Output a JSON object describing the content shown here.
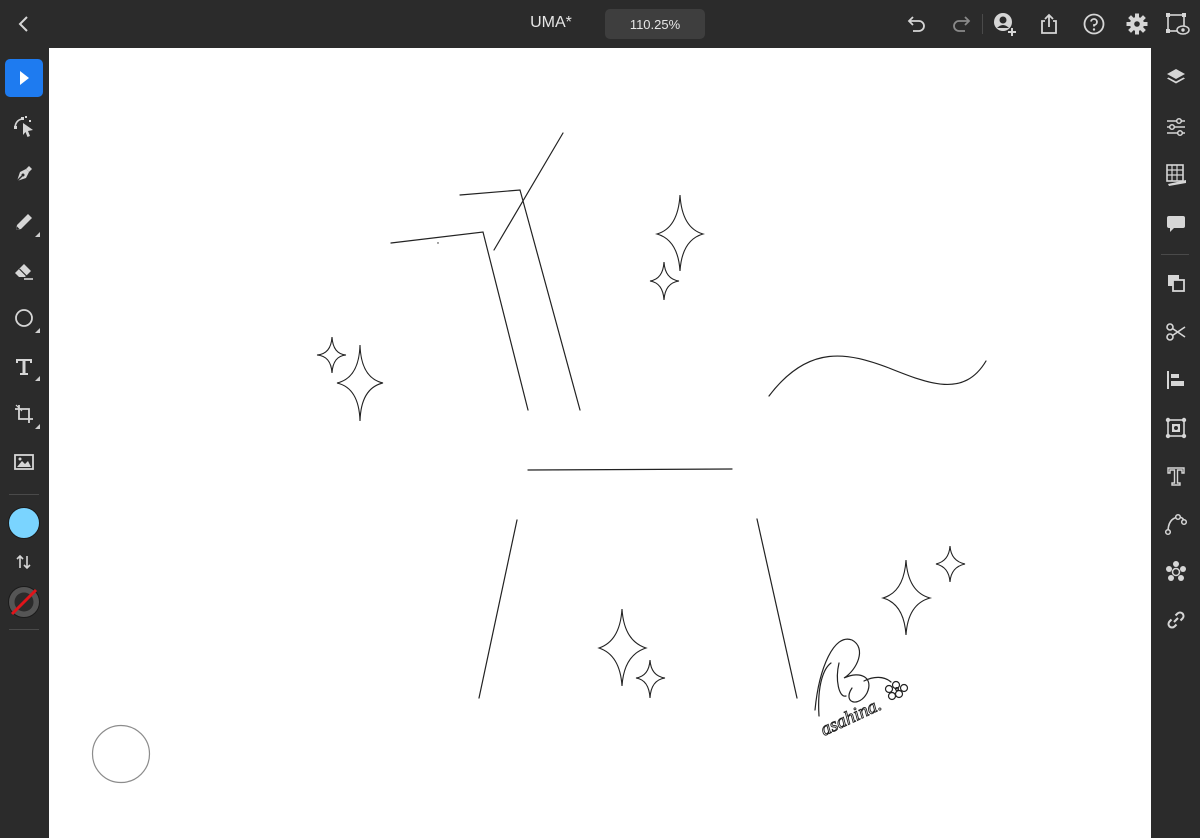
{
  "topbar": {
    "title": "UMA*",
    "zoom": "110.25%",
    "icons": [
      "back-icon",
      "undo-icon",
      "redo-icon",
      "invite-icon",
      "share-icon",
      "help-icon",
      "settings-icon",
      "preview-icon"
    ]
  },
  "left_toolbar": {
    "tools": [
      "select-icon",
      "direct-select-icon",
      "pen-icon",
      "pencil-icon",
      "eraser-icon",
      "shape-icon",
      "text-icon",
      "crop-icon",
      "image-icon"
    ],
    "active_tool": "select",
    "fill_color": "#7ad4ff",
    "stroke_color": "none"
  },
  "right_panel": {
    "icons": [
      "layers-icon",
      "properties-icon",
      "libraries-icon",
      "comments-icon",
      "arrange-icon",
      "scissors-icon",
      "align-icon",
      "transform-icon",
      "type-icon",
      "path-icon",
      "repeat-icon",
      "link-icon"
    ]
  },
  "canvas": {
    "background": "#ffffff",
    "signature_text": "asahina."
  },
  "colors": {
    "accent": "#1e7bf0",
    "chrome": "#2b2b2b",
    "icon": "#d6d6d6"
  }
}
